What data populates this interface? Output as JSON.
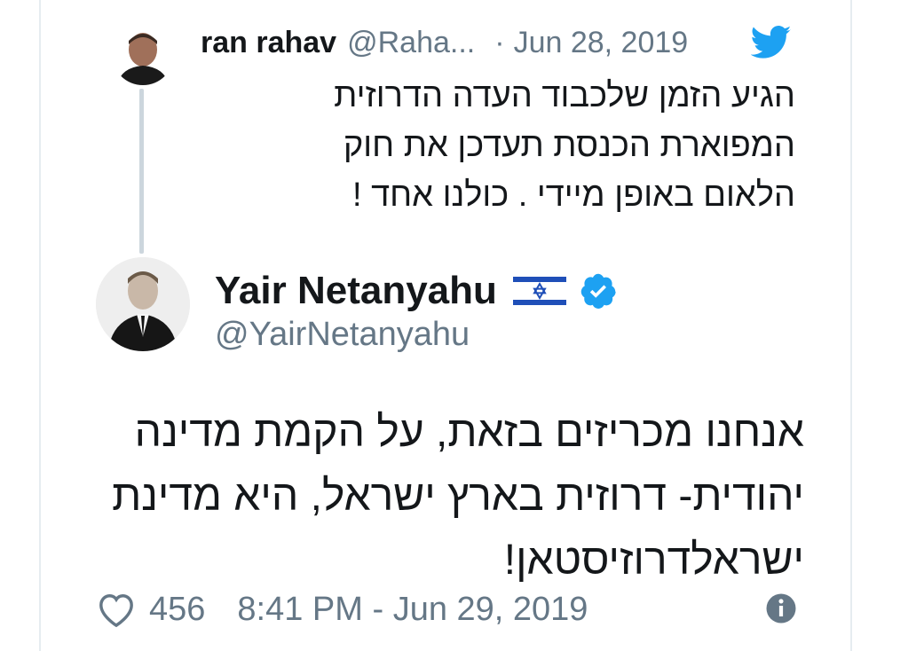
{
  "parent_tweet": {
    "name": "ran rahav",
    "handle": "@Raha...",
    "separator": "·",
    "date": "Jun 28, 2019",
    "text_lines": [
      "הגיע הזמן שלכבוד העדה הדרוזית",
      "המפוארת הכנסת תעדכן את חוק",
      "הלאום באופן מיידי . כולנו אחד !"
    ],
    "icon": "twitter-bird-icon",
    "icon_color": "#1da1f2"
  },
  "main_tweet": {
    "name": "Yair Netanyahu",
    "handle": "@YairNetanyahu",
    "flag_icon": "israel-flag-icon",
    "verified_icon": "verified-badge-icon",
    "text_lines": [
      "אנחנו מכריזים בזאת, על הקמת מדינה",
      "יהודית- דרוזית בארץ ישראל, היא מדינת",
      "ישראלדרוזיסטאן!"
    ],
    "likes": "456",
    "timestamp": "8:41 PM - Jun 29, 2019",
    "info_icon": "info-icon"
  },
  "colors": {
    "accent": "#1da1f2",
    "secondary_text": "#657786",
    "primary_text": "#14171a",
    "thread_line": "#ccd6dd"
  }
}
